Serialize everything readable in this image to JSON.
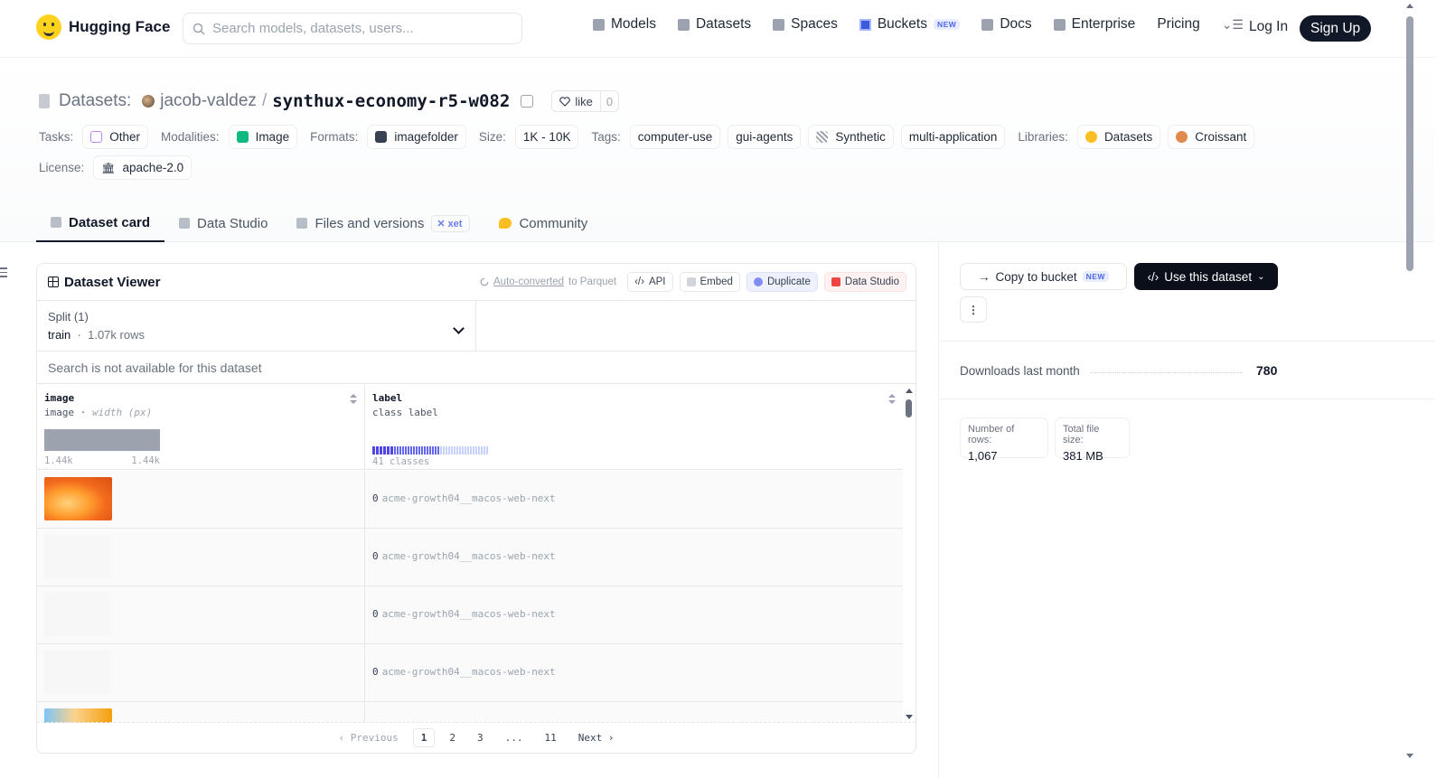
{
  "nav": {
    "brand": "Hugging Face",
    "search_placeholder": "Search models, datasets, users...",
    "links": [
      "Models",
      "Datasets",
      "Spaces",
      "Buckets",
      "Docs",
      "Enterprise",
      "Pricing"
    ],
    "buckets_badge": "NEW",
    "login": "Log In",
    "signup": "Sign Up"
  },
  "header": {
    "prefix": "Datasets:",
    "owner": "jacob-valdez",
    "repo": "synthux-economy-r5-w082",
    "like_label": "like",
    "like_count": "0"
  },
  "meta": {
    "tasks_label": "Tasks:",
    "tasks": [
      "Other"
    ],
    "modalities_label": "Modalities:",
    "modalities": [
      "Image"
    ],
    "formats_label": "Formats:",
    "formats": [
      "imagefolder"
    ],
    "size_label": "Size:",
    "size": "1K - 10K",
    "tags_label": "Tags:",
    "tags": [
      "computer-use",
      "gui-agents",
      "Synthetic",
      "multi-application"
    ],
    "libraries_label": "Libraries:",
    "libraries": [
      "Datasets",
      "Croissant"
    ],
    "license_label": "License:",
    "license": "apache-2.0"
  },
  "tabs": {
    "dataset_card": "Dataset card",
    "data_studio": "Data Studio",
    "files": "Files and versions",
    "xet": "xet",
    "community": "Community"
  },
  "viewer": {
    "title": "Dataset Viewer",
    "auto_converted": "Auto-converted",
    "to_parquet": "to Parquet",
    "api": "API",
    "embed": "Embed",
    "duplicate": "Duplicate",
    "data_studio": "Data Studio",
    "split_label": "Split (1)",
    "split_name": "train",
    "split_rows": "1.07k rows",
    "search_disabled": "Search is not available for this dataset",
    "columns": {
      "image": {
        "name": "image",
        "type": "image",
        "type_extra": "width (px)",
        "min": "1.44k",
        "max": "1.44k"
      },
      "label": {
        "name": "label",
        "type": "class label",
        "classes": "41 classes"
      }
    },
    "rows": [
      {
        "thumb": "orange",
        "class_id": "0",
        "class_name": "acme-growth04__macos-web-next"
      },
      {
        "thumb": "blank",
        "class_id": "0",
        "class_name": "acme-growth04__macos-web-next"
      },
      {
        "thumb": "blank",
        "class_id": "0",
        "class_name": "acme-growth04__macos-web-next"
      },
      {
        "thumb": "blank",
        "class_id": "0",
        "class_name": "acme-growth04__macos-web-next"
      },
      {
        "thumb": "orange",
        "class_id": "",
        "class_name": ""
      }
    ],
    "pagination": {
      "previous": "Previous",
      "pages": [
        "1",
        "2",
        "3",
        "...",
        "11"
      ],
      "next": "Next",
      "current": "1"
    }
  },
  "sidebar": {
    "copy_bucket": "Copy to bucket",
    "copy_badge": "NEW",
    "use_dataset": "Use this dataset",
    "downloads_label": "Downloads last month",
    "downloads_value": "780",
    "rows_label": "Number of rows:",
    "rows_value": "1,067",
    "size_label": "Total file size:",
    "size_value": "381 MB"
  }
}
